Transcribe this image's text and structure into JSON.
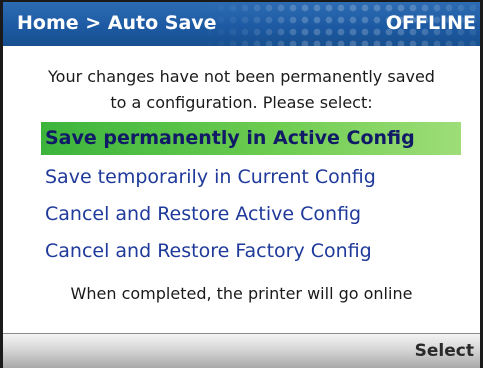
{
  "header": {
    "breadcrumb": "Home > Auto Save",
    "status": "OFFLINE"
  },
  "message": {
    "line1": "Your changes have not been permanently saved",
    "line2": "to a configuration. Please select:"
  },
  "menu": {
    "selected_index": 0,
    "items": [
      {
        "label": "Save permanently in Active Config"
      },
      {
        "label": "Save temporarily in Current Config"
      },
      {
        "label": "Cancel and Restore Active Config"
      },
      {
        "label": "Cancel and Restore Factory Config"
      }
    ]
  },
  "footer_note": "When completed, the printer will go online",
  "softkeys": {
    "right_label": "Select"
  },
  "colors": {
    "header_blue": "#1d5aa3",
    "menu_text_blue": "#1f3a9a",
    "selection_green": "#6ccc50"
  }
}
